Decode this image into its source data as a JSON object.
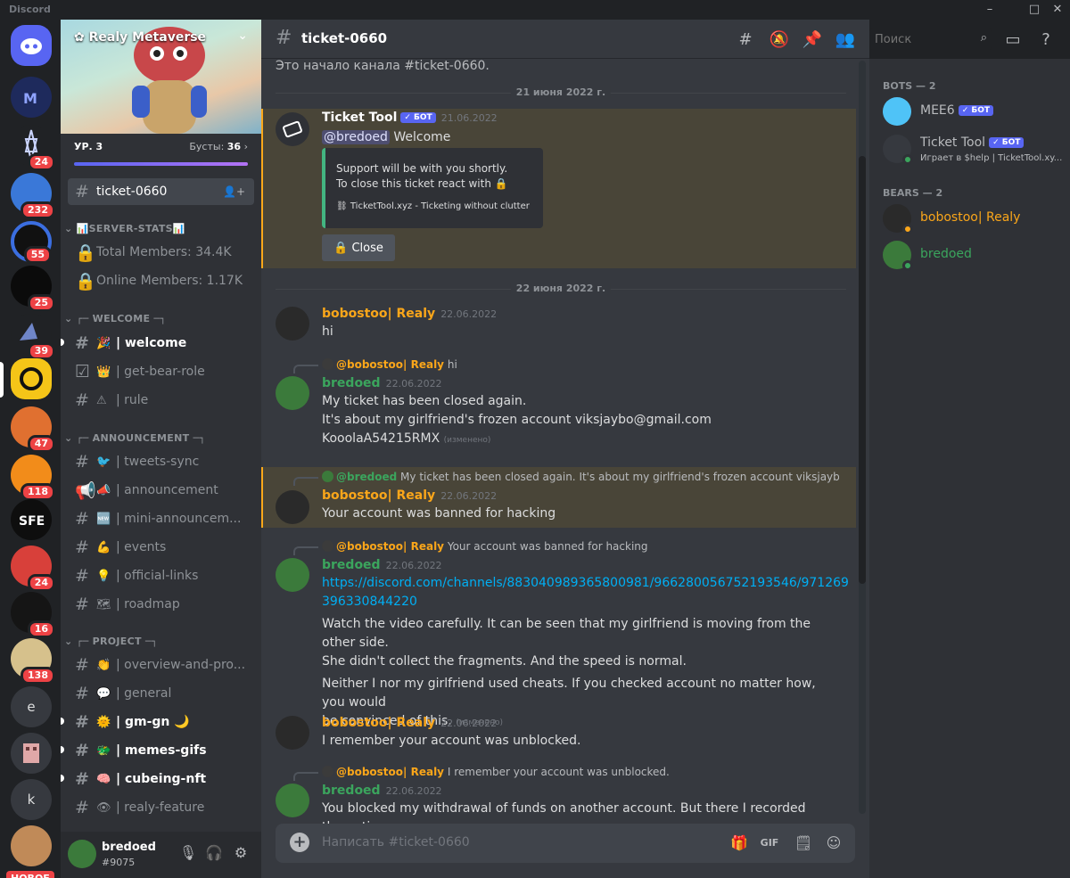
{
  "app": {
    "brand": "Discord"
  },
  "colors": {
    "accent": "#5865f2",
    "bobostoo": "#faa61a",
    "bredoed": "#3ba55d",
    "link": "#00aff4",
    "badge": "#ed4245"
  },
  "rail": {
    "badges": [
      "24",
      "232",
      "55",
      "25",
      "39",
      "47",
      "118",
      "24",
      "16",
      "138"
    ],
    "letters": [
      "e",
      "k"
    ],
    "new_label": "НОВОЕ"
  },
  "server": {
    "name": "Realy Metaverse",
    "level": "УР. 3",
    "boosts_label": "Бусты:",
    "boosts": "36"
  },
  "channels": {
    "active": "ticket-0660",
    "cat_stats": "SERVER-STATS",
    "stat1": "Total Members: 34.4K",
    "stat2": "Online Members: 1.17K",
    "cat_welcome": "┌─ WELCOME ─┐",
    "welcome": "| welcome",
    "getbear": "| get-bear-role",
    "rule": "| rule",
    "cat_announce": "┌─ ANNOUNCEMENT ─┐",
    "tweets": "| tweets-sync",
    "announcement": "| announcement",
    "mini": "| mini-announcem...",
    "events": "| events",
    "official": "| official-links",
    "roadmap": "| roadmap",
    "cat_project": "┌─ PROJECT ─┐",
    "overview": "| overview-and-pro...",
    "general": "| general",
    "gmgn": "| gm-gn 🌙",
    "memes": "| memes-gifs",
    "cubeing": "| cubeing-nft",
    "realyfeature": "| realy-feature"
  },
  "user": {
    "name": "bredoed",
    "tag": "#9075"
  },
  "header": {
    "channel": "ticket-0660",
    "search_placeholder": "Поиск"
  },
  "chat": {
    "start": "Это начало канала #ticket-0660.",
    "date1": "21 июня 2022 г.",
    "date2": "22 июня 2022 г.",
    "bot_label": "✓ БОТ",
    "edited": "(изменено)",
    "m1": {
      "author": "Ticket Tool",
      "time": "21.06.2022",
      "mention": "@bredoed",
      "text": "Welcome",
      "embed1": "Support will be with you shortly.",
      "embed2": "To close this ticket react with 🔒",
      "footer": "TicketTool.xyz - Ticketing without clutter",
      "button": "🔒 Close"
    },
    "m2": {
      "author": "bobostoo| Realy",
      "time": "22.06.2022",
      "text": "hi"
    },
    "m3": {
      "reply_author": "@bobostoo| Realy",
      "reply_text": "hi",
      "author": "bredoed",
      "time": "22.06.2022",
      "l1": "My ticket has been closed again.",
      "l2": "It's about my girlfriend's frozen account viksjaybo@gmail.com",
      "l3": "KooolaA54215RMX"
    },
    "m4": {
      "reply_author": "@bredoed",
      "reply_text": "My ticket has been closed again. It's about my girlfriend's frozen account viksjaybo@g...",
      "author": "bobostoo| Realy",
      "time": "22.06.2022",
      "text": "Your account was banned for hacking"
    },
    "m5": {
      "reply_author": "@bobostoo| Realy",
      "reply_text": "Your account was banned for hacking",
      "author": "bredoed",
      "time": "22.06.2022",
      "link1": "https://discord.com/channels/883040989365800981/966280056752193546/971269",
      "link2": "396330844220",
      "l1": "Watch the video carefully. It can be seen that my girlfriend is moving from the other side.",
      "l2": "She didn't collect the fragments. And the speed is normal.",
      "l3": "Neither I nor my girlfriend used cheats. If you checked account no matter how, you would",
      "l4": "be convinced of this."
    },
    "m6": {
      "author": "bobostoo| Realy",
      "time": "22.06.2022",
      "text": "I remember your account was unblocked."
    },
    "m7": {
      "reply_author": "@bobostoo| Realy",
      "reply_text": "I remember your account was unblocked.",
      "author": "bredoed",
      "time": "22.06.2022",
      "text": "You blocked my withdrawal of funds on another account. But there I recorded the entire"
    },
    "input_placeholder": "Написать #ticket-0660"
  },
  "members": {
    "cat_bots": "BOTS — 2",
    "mee6": "MEE6",
    "tickettool": "Ticket Tool",
    "tickettool_activity": "Играет в $help | TicketTool.xy...",
    "cat_bears": "BEARS — 2",
    "bobostoo": "bobostoo| Realy",
    "bredoed": "bredoed"
  }
}
